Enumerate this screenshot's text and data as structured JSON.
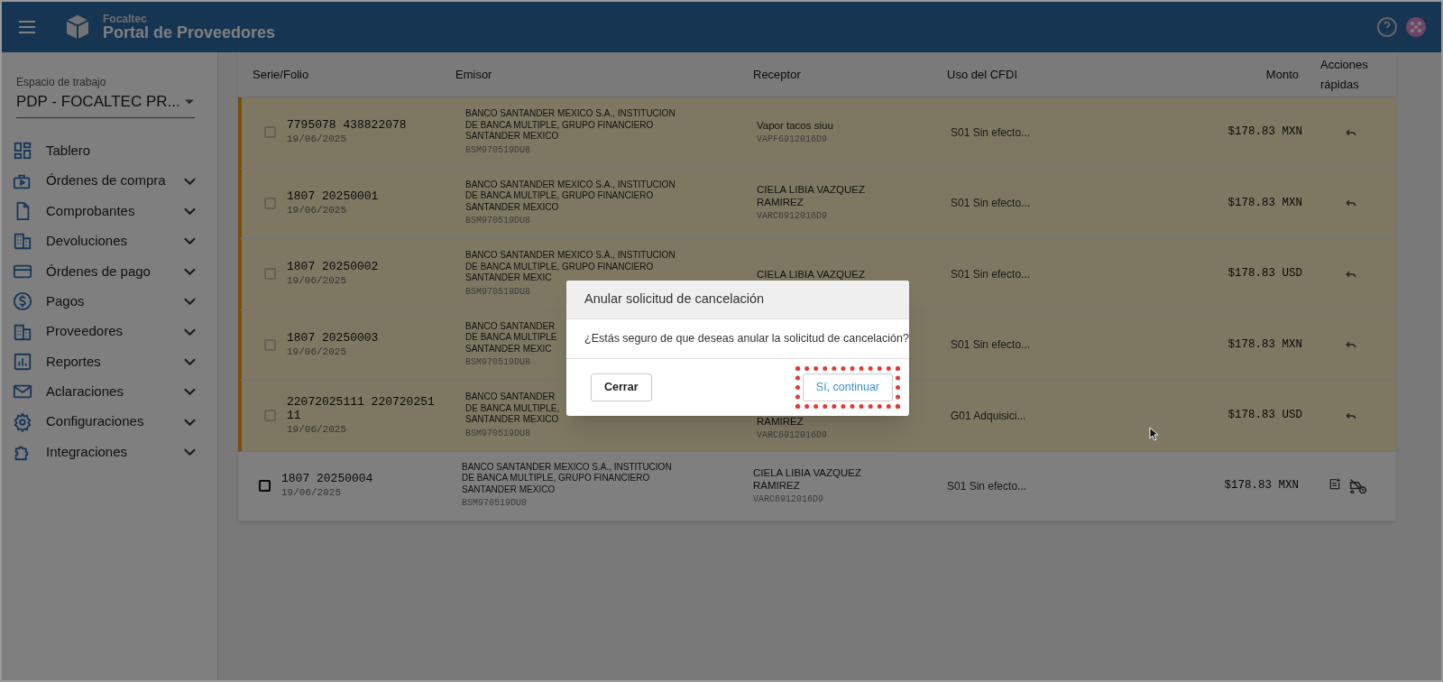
{
  "header": {
    "brand_small": "Focaltec",
    "brand": "Portal de Proveedores"
  },
  "sidebar": {
    "workspace_label": "Espacio de trabajo",
    "workspace_value": "PDP - FOCALTEC PR...",
    "items": [
      {
        "label": "Tablero",
        "expandable": false
      },
      {
        "label": "Órdenes de compra",
        "expandable": true
      },
      {
        "label": "Comprobantes",
        "expandable": true
      },
      {
        "label": "Devoluciones",
        "expandable": true
      },
      {
        "label": "Órdenes de pago",
        "expandable": true
      },
      {
        "label": "Pagos",
        "expandable": true
      },
      {
        "label": "Proveedores",
        "expandable": true
      },
      {
        "label": "Reportes",
        "expandable": true
      },
      {
        "label": "Aclaraciones",
        "expandable": true
      },
      {
        "label": "Configuraciones",
        "expandable": true
      },
      {
        "label": "Integraciones",
        "expandable": true
      }
    ]
  },
  "table": {
    "columns": [
      "Serie/Folio",
      "Emisor",
      "Receptor",
      "Uso del CFDI",
      "Monto",
      "Acciones rápidas"
    ],
    "rows": [
      {
        "folio": "7795078 438822078",
        "date": "19/06/2025",
        "emisor": "BANCO SANTANDER MEXICO S.A., INSTITUCION\nDE BANCA MULTIPLE, GRUPO FINANCIERO\nSANTANDER MEXICO",
        "emisor_rfc": "BSM970519DU8",
        "receptor": "Vapor tacos siuu",
        "receptor_rfc": "VAPF6912016D9",
        "uso": "S01 Sin efecto...",
        "monto": "$178.83 MXN",
        "pending_cancel": true
      },
      {
        "folio": "1807 20250001",
        "date": "19/06/2025",
        "emisor": "BANCO SANTANDER MEXICO S.A., INSTITUCION\nDE BANCA MULTIPLE, GRUPO FINANCIERO\nSANTANDER MEXICO",
        "emisor_rfc": "BSM970519DU8",
        "receptor": "CIELA LIBIA VAZQUEZ RAMIREZ",
        "receptor_rfc": "VARC6912016D9",
        "uso": "S01 Sin efecto...",
        "monto": "$178.83 MXN",
        "pending_cancel": true
      },
      {
        "folio": "1807 20250002",
        "date": "19/06/2025",
        "emisor": "BANCO SANTANDER MEXICO S.A., INSTITUCION\nDE BANCA MULTIPLE, GRUPO FINANCIERO\nSANTANDER MEXIC",
        "emisor_rfc": "BSM970519DU8",
        "receptor": "CIELA LIBIA VAZQUEZ",
        "uso": "S01 Sin efecto...",
        "monto": "$178.83 USD",
        "pending_cancel": true
      },
      {
        "folio": "1807 20250003",
        "date": "19/06/2025",
        "emisor": "BANCO SANTANDER\nDE BANCA MULTIPLE\nSANTANDER MEXIC",
        "emisor_rfc": "BSM970519DU8",
        "uso": "S01 Sin efecto...",
        "monto": "$178.83 MXN",
        "pending_cancel": true
      },
      {
        "folio": "22072025111 220720251 11",
        "date": "19/06/2025",
        "emisor": "BANCO SANTANDER\nDE BANCA MULTIPLE,\nSANTANDER MEXICO",
        "emisor_rfc": "BSM970519DU8",
        "receptor": "RAMIREZ",
        "receptor_rfc": "VARC6912016D9",
        "uso": "G01 Adquisici...",
        "monto": "$178.83 USD",
        "pending_cancel": true
      },
      {
        "folio": "1807 20250004",
        "date": "19/06/2025",
        "emisor": "BANCO SANTANDER MEXICO S.A., INSTITUCION\nDE BANCA MULTIPLE, GRUPO FINANCIERO\nSANTANDER MEXICO",
        "emisor_rfc": "BSM970519DU8",
        "receptor": "CIELA LIBIA VAZQUEZ RAMIREZ",
        "receptor_rfc": "VARC6912016D9",
        "uso": "S01 Sin efecto...",
        "monto": "$178.83 MXN",
        "pending_cancel": false
      }
    ]
  },
  "dialog": {
    "title": "Anular solicitud de cancelación",
    "message": "¿Estás seguro de que deseas anular la solicitud de cancelación?",
    "buttons": [
      {
        "label": "Cerrar",
        "kind": "secondary"
      },
      {
        "label": "Sí, continuar",
        "kind": "primary",
        "highlighted": true
      }
    ]
  }
}
